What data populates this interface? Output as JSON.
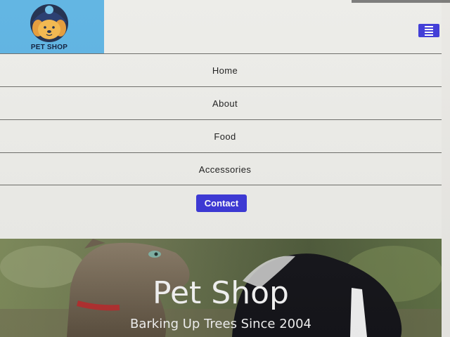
{
  "header": {
    "logo_text": "PET SHOP",
    "menu_icon": "hamburger-icon"
  },
  "nav": {
    "items": [
      {
        "label": "Home"
      },
      {
        "label": "About"
      },
      {
        "label": "Food"
      },
      {
        "label": "Accessories"
      }
    ],
    "contact_label": "Contact"
  },
  "hero": {
    "title": "Pet Shop",
    "subtitle": "Barking Up Trees Since 2004"
  },
  "colors": {
    "accent": "#3a36d6",
    "logo_bg": "#5bb2e2",
    "page_bg": "#ecece8"
  }
}
